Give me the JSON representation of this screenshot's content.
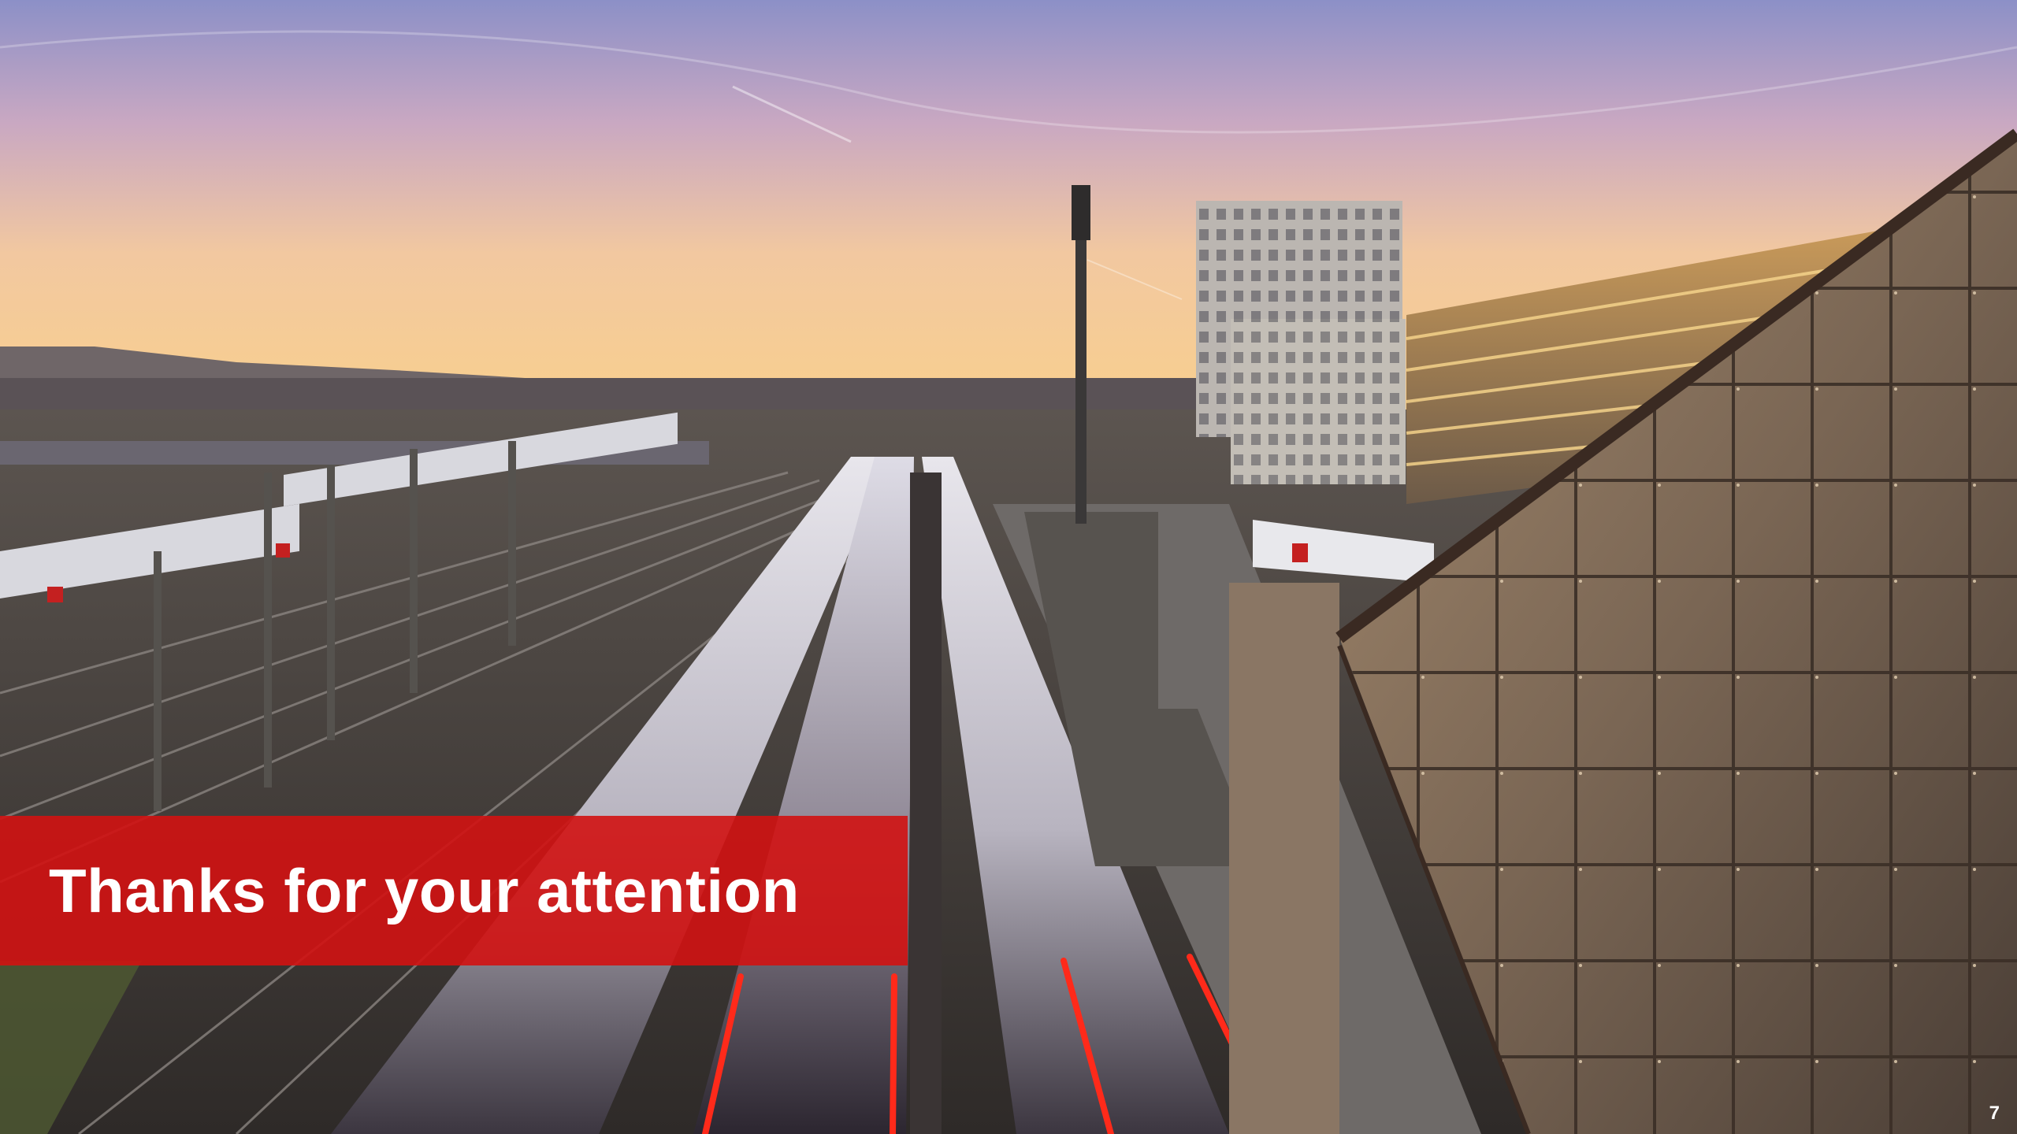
{
  "slide": {
    "title": "Thanks for your attention",
    "page_number": "7"
  },
  "photo": {
    "subject": "rail-yard-at-sunset",
    "colors": {
      "sky_top": "#8f92c6",
      "sky_horizon": "#f6c98e",
      "banner": "#d21212",
      "tail_light": "#ff2a1a"
    }
  }
}
